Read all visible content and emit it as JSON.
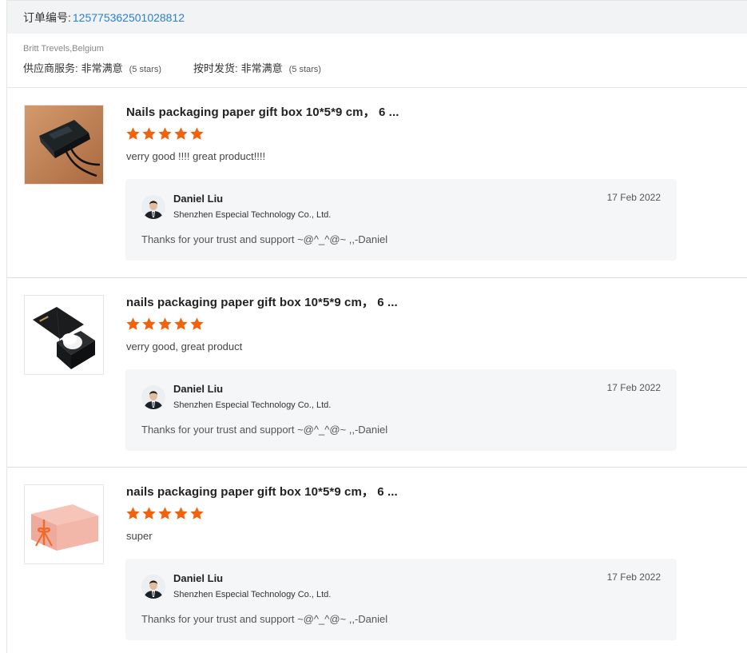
{
  "order": {
    "label": "订单编号:",
    "number": "125775362501028812"
  },
  "buyer": {
    "name": "Britt Trevels,Belgium",
    "ratings": [
      {
        "label": "供应商服务:",
        "value": "非常满意",
        "stars": "(5 stars)"
      },
      {
        "label": "按时发货:",
        "value": "非常满意",
        "stars": "(5 stars)"
      }
    ]
  },
  "colors": {
    "star": "#f0620c",
    "order_link": "#2a7fd4"
  },
  "reviews": [
    {
      "title": "Nails packaging paper gift box 10*5*9 cm， 6 ...",
      "rating": 5,
      "comment": "verry good !!!! great product!!!!",
      "image": "black-flat-gift-box-with-ribbon",
      "reply": {
        "name": "Daniel Liu",
        "company": "Shenzhen Especial Technology Co., Ltd.",
        "date": "17 Feb 2022",
        "message": "Thanks for your trust and support  ~@^_^@~ ,,-Daniel"
      }
    },
    {
      "title": "nails packaging paper gift box 10*5*9 cm， 6 ...",
      "rating": 5,
      "comment": "verry good, great product",
      "image": "black-open-gift-box",
      "reply": {
        "name": "Daniel Liu",
        "company": "Shenzhen Especial Technology Co., Ltd.",
        "date": "17 Feb 2022",
        "message": "Thanks for your trust and support  ~@^_^@~ ,,-Daniel"
      }
    },
    {
      "title": "nails packaging paper gift box 10*5*9 cm， 6 ...",
      "rating": 5,
      "comment": "super",
      "image": "pink-gift-box-with-bow",
      "reply": {
        "name": "Daniel Liu",
        "company": "Shenzhen Especial Technology Co., Ltd.",
        "date": "17 Feb 2022",
        "message": "Thanks for your trust and support  ~@^_^@~ ,,-Daniel"
      }
    }
  ]
}
